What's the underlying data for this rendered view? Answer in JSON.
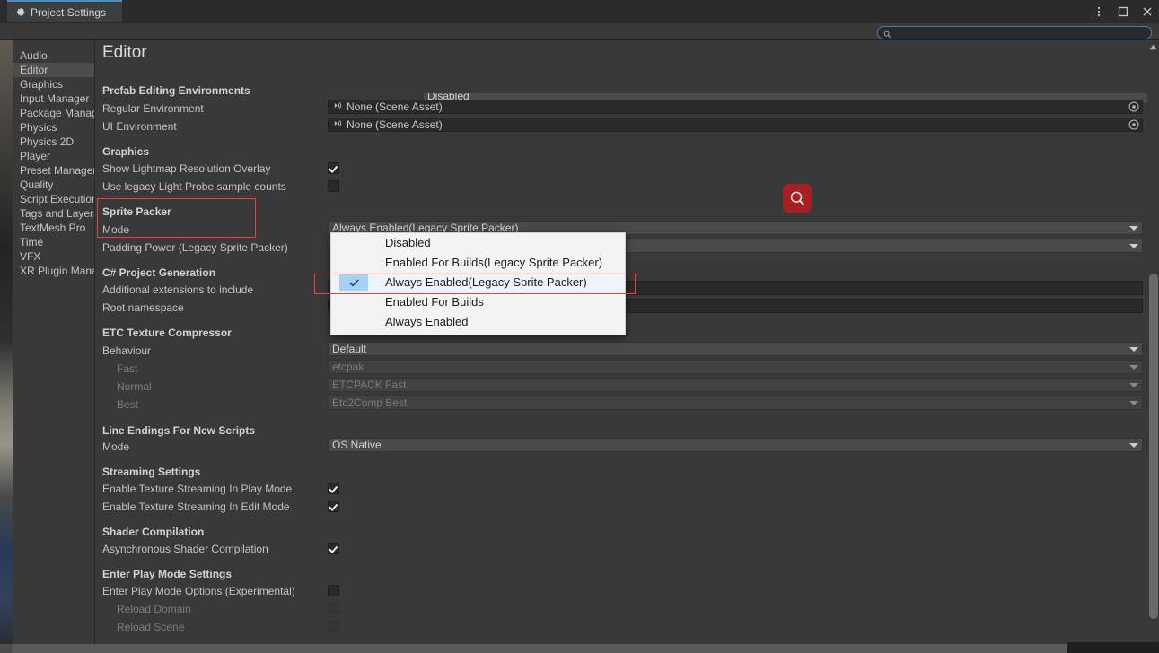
{
  "window": {
    "tab_label": "Project Settings",
    "gear_icon": "gear-icon",
    "menu_icon": "kebab-menu-icon",
    "maximize_icon": "maximize-icon",
    "close_icon": "close-icon"
  },
  "search": {
    "value": "",
    "placeholder": "",
    "icon": "search-icon"
  },
  "toolbar": {
    "sliders_icon": "sliders-icon",
    "settings_icon": "gear-icon"
  },
  "sidebar": {
    "items": [
      {
        "label": "Audio",
        "selected": false
      },
      {
        "label": "Editor",
        "selected": true
      },
      {
        "label": "Graphics",
        "selected": false
      },
      {
        "label": "Input Manager",
        "selected": false
      },
      {
        "label": "Package Manag",
        "selected": false
      },
      {
        "label": "Physics",
        "selected": false
      },
      {
        "label": "Physics 2D",
        "selected": false
      },
      {
        "label": "Player",
        "selected": false
      },
      {
        "label": "Preset Manager",
        "selected": false
      },
      {
        "label": "Quality",
        "selected": false
      },
      {
        "label": "Script Execution",
        "selected": false
      },
      {
        "label": "Tags and Layers",
        "selected": false
      },
      {
        "label": "TextMesh Pro",
        "selected": false
      },
      {
        "label": "Time",
        "selected": false
      },
      {
        "label": "VFX",
        "selected": false
      },
      {
        "label": "XR Plugin Manag",
        "selected": false
      }
    ]
  },
  "main": {
    "title": "Editor",
    "clipped_top_field": "Disabled",
    "sections": {
      "prefab": {
        "header": "Prefab Editing Environments",
        "regular_label": "Regular Environment",
        "regular_value": "None (Scene Asset)",
        "ui_label": "UI Environment",
        "ui_value": "None (Scene Asset)",
        "object_icon": "scene-asset-icon",
        "picker_icon": "object-picker-icon"
      },
      "graphics": {
        "header": "Graphics",
        "lightmap_label": "Show Lightmap Resolution Overlay",
        "lightmap_checked": true,
        "legacy_probe_label": "Use legacy Light Probe sample counts",
        "legacy_probe_checked": false
      },
      "sprite_packer": {
        "header": "Sprite Packer",
        "mode_label": "Mode",
        "mode_value": "Always Enabled(Legacy Sprite Packer)",
        "padding_label": "Padding Power (Legacy Sprite Packer)",
        "padding_value": ""
      },
      "csharp": {
        "header": "C# Project Generation",
        "extensions_label": "Additional extensions to include",
        "extensions_value": "",
        "namespace_label": "Root namespace",
        "namespace_value": ""
      },
      "etc": {
        "header": "ETC Texture Compressor",
        "behaviour_label": "Behaviour",
        "behaviour_value": "Default",
        "fast_label": "Fast",
        "fast_value": "etcpak",
        "normal_label": "Normal",
        "normal_value": "ETCPACK Fast",
        "best_label": "Best",
        "best_value": "Etc2Comp Best"
      },
      "line_endings": {
        "header": "Line Endings For New Scripts",
        "mode_label": "Mode",
        "mode_value": "OS Native"
      },
      "streaming": {
        "header": "Streaming Settings",
        "play_label": "Enable Texture Streaming In Play Mode",
        "play_checked": true,
        "edit_label": "Enable Texture Streaming In Edit Mode",
        "edit_checked": true
      },
      "shader": {
        "header": "Shader Compilation",
        "async_label": "Asynchronous Shader Compilation",
        "async_checked": true
      },
      "play_mode": {
        "header": "Enter Play Mode Settings",
        "options_label": "Enter Play Mode Options (Experimental)",
        "options_checked": false,
        "reload_domain_label": "Reload Domain",
        "reload_domain_checked": false,
        "reload_scene_label": "Reload Scene",
        "reload_scene_checked": false
      }
    }
  },
  "dropdown": {
    "items": [
      {
        "label": "Disabled",
        "checked": false
      },
      {
        "label": "Enabled For Builds(Legacy Sprite Packer)",
        "checked": false
      },
      {
        "label": "Always Enabled(Legacy Sprite Packer)",
        "checked": true
      },
      {
        "label": "Enabled For Builds",
        "checked": false
      },
      {
        "label": "Always Enabled",
        "checked": false
      }
    ],
    "check_icon": "checkmark-icon"
  },
  "annotations": {
    "magnifier_icon": "magnifier-icon",
    "accent_color": "#e8443c",
    "magnifier_bg": "#a81f1f"
  }
}
